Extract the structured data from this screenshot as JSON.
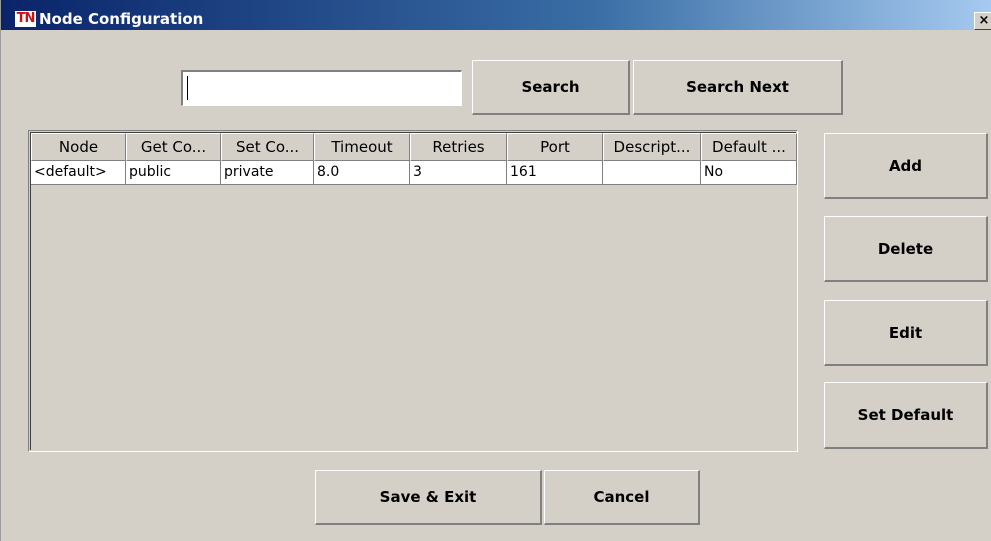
{
  "window": {
    "title": "Node Configuration",
    "icon": "tn-app-icon",
    "close_label": "×"
  },
  "search": {
    "value": "",
    "search_label": "Search",
    "search_next_label": "Search Next"
  },
  "table": {
    "columns": [
      "Node",
      "Get Co...",
      "Set Co...",
      "Timeout",
      "Retries",
      "Port",
      "Descript...",
      "Default ..."
    ],
    "rows": [
      [
        "<default>",
        "public",
        "private",
        "8.0",
        "3",
        "161",
        "",
        "No"
      ]
    ]
  },
  "side_buttons": {
    "add": "Add",
    "delete": "Delete",
    "edit": "Edit",
    "set_default": "Set Default"
  },
  "footer": {
    "save_exit": "Save & Exit",
    "cancel": "Cancel"
  },
  "colors": {
    "title_start": "#0a246a",
    "title_end": "#a6caf0",
    "face": "#d4d0c8"
  }
}
